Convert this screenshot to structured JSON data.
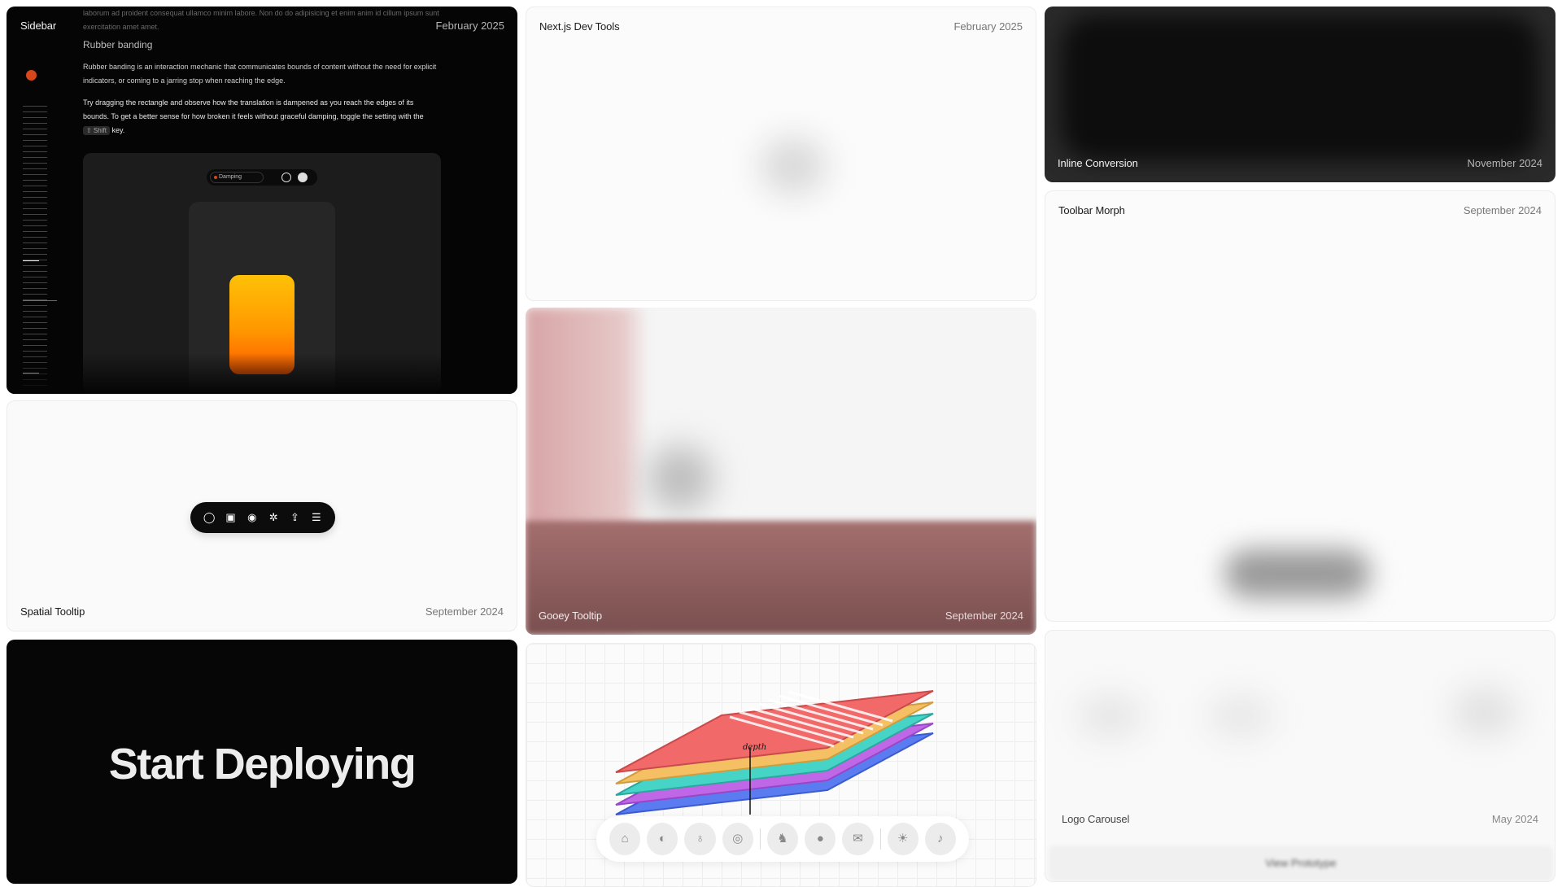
{
  "cards": {
    "sidebar": {
      "title": "Sidebar",
      "date": "February 2025",
      "faint_text": "laborum ad proident consequat ullamco minim labore. Non do do adipisicing et enim anim id cillum ipsum sunt exercitation amet amet.",
      "heading": "Rubber banding",
      "paragraph1": "Rubber banding is an interaction mechanic that communicates bounds of content without the need for explicit indicators, or coming to a jarring stop when reaching the edge.",
      "paragraph2_pre": "Try dragging the rectangle and observe how the translation is dampened as you reach the edges of its bounds. To get a better sense for how broken it feels without graceful damping, toggle the setting with the",
      "kbd": "⇧ Shift",
      "paragraph2_post": "key.",
      "control_label": "Damping",
      "accent_color": "#d6471b"
    },
    "spatial": {
      "title": "Spatial Tooltip",
      "date": "September 2024",
      "toolbar_icons": [
        "comment-icon",
        "inbox-icon",
        "eye-icon",
        "gear-icon",
        "share-icon",
        "menu-icon"
      ]
    },
    "deploy": {
      "text": "Start Deploying"
    },
    "nextjs": {
      "title": "Next.js Dev Tools",
      "date": "February 2025"
    },
    "gooey": {
      "title": "Gooey Tooltip",
      "date": "September 2024"
    },
    "layers": {
      "label": "depth",
      "dock_icons": [
        "home-icon",
        "paint-icon",
        "bulb-icon",
        "camera-icon",
        "bird-icon",
        "github-icon",
        "mail-icon",
        "sun-icon",
        "volume-icon"
      ]
    },
    "inline": {
      "title": "Inline Conversion",
      "date": "November 2024"
    },
    "morph": {
      "title": "Toolbar Morph",
      "date": "September 2024"
    },
    "logo": {
      "title": "Logo Carousel",
      "date": "May 2024",
      "view_button": "View Prototype"
    }
  }
}
